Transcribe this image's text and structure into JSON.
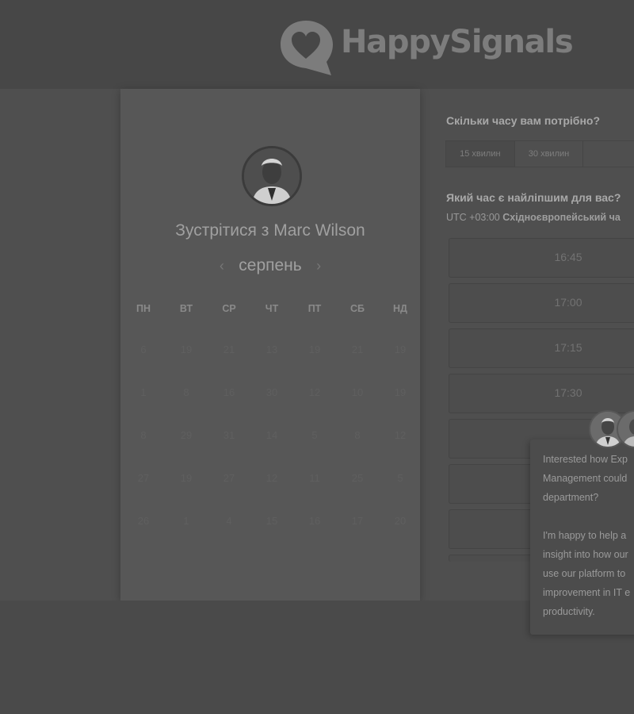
{
  "brand": {
    "name": "HappySignals"
  },
  "card": {
    "title": "Зустрітися з Marc Wilson",
    "month": "серпень",
    "prev_arrow": "‹",
    "next_arrow": "›",
    "weekdays": [
      "ПН",
      "ВТ",
      "СР",
      "ЧТ",
      "ПТ",
      "СБ",
      "НД"
    ],
    "days": [
      [
        "6",
        "19",
        "21",
        "13",
        "19",
        "21",
        "19"
      ],
      [
        "1",
        "8",
        "16",
        "30",
        "12",
        "10",
        "19"
      ],
      [
        "8",
        "29",
        "31",
        "14",
        "5",
        "8",
        "12"
      ],
      [
        "27",
        "19",
        "27",
        "12",
        "11",
        "25",
        "5"
      ],
      [
        "26",
        "1",
        "4",
        "15",
        "16",
        "17",
        "20"
      ]
    ]
  },
  "duration": {
    "question": "Скільки часу вам потрібно?",
    "options": [
      "15 хвилин",
      "30 хвилин",
      ""
    ],
    "selected": "15 хвилин"
  },
  "time": {
    "question": "Який час є найліпшим для вас?",
    "timezone_prefix": "UTC +03:00",
    "timezone_name": "Східноєвропейський ча",
    "slots": [
      "16:45",
      "17:00",
      "17:15",
      "17:30",
      "",
      "",
      "",
      ""
    ]
  },
  "chat": {
    "message": "Interested how Exp\nManagement could\ndepartment?\n\nI'm happy to help a\ninsight into how our\nuse our platform to\nimprovement in IT e\nproductivity."
  },
  "colors": {
    "background": "#4b4b4b",
    "card": "#575757",
    "text_light": "#a0a0a0"
  }
}
